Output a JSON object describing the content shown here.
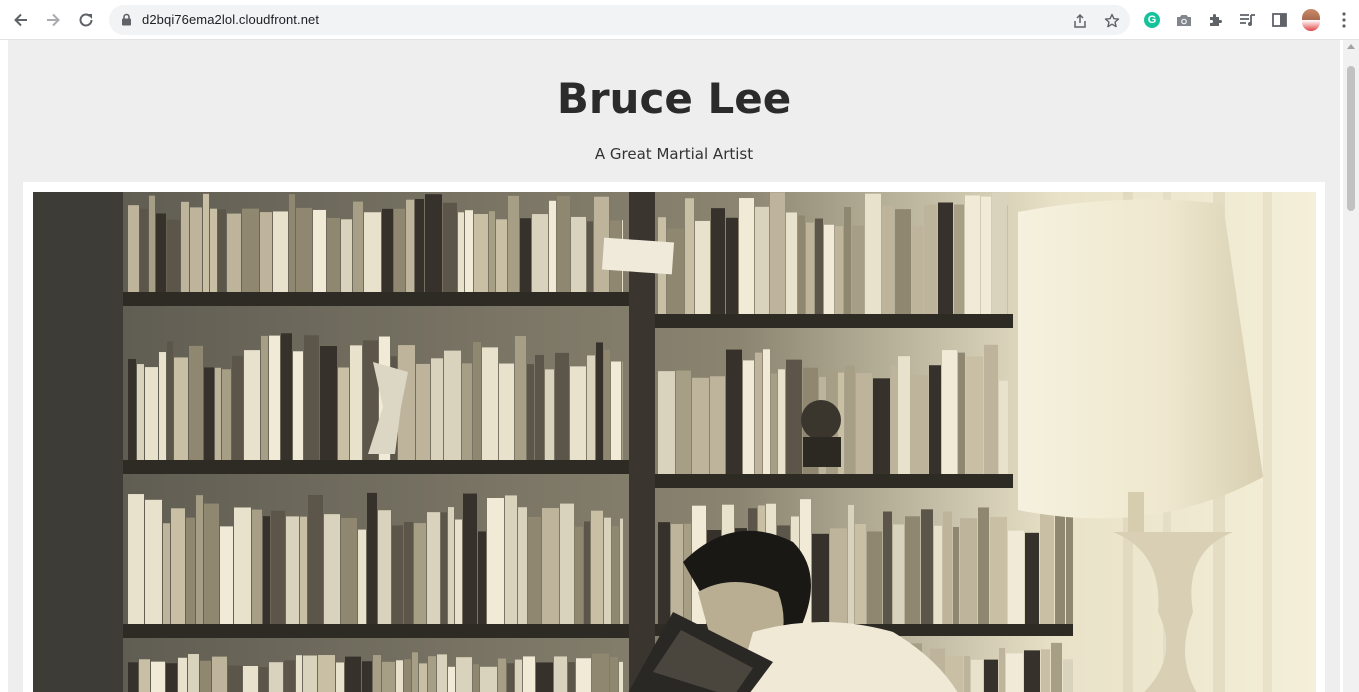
{
  "browser": {
    "url": "d2bqi76ema2lol.cloudfront.net",
    "nav": {
      "back_icon": "arrow-left-icon",
      "forward_icon": "arrow-right-icon",
      "reload_icon": "reload-icon"
    },
    "omnibox_icons": [
      "share-icon",
      "star-icon"
    ],
    "extensions": [
      "grammarly-icon",
      "camera-icon",
      "puzzle-icon",
      "media-queue-icon",
      "side-panel-icon",
      "profile-avatar",
      "more-vert-icon"
    ],
    "grammarly_letter": "G"
  },
  "page": {
    "title": "Bruce Lee",
    "subtitle": "A Great Martial Artist",
    "background": "#eeeeee",
    "image_alt_subject": "sepia photo of a man reading a book in front of bookshelves beside a lamp"
  }
}
